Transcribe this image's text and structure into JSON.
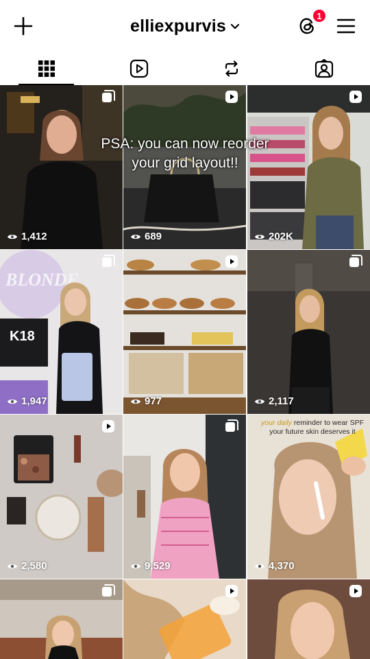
{
  "header": {
    "username": "elliexpurvis",
    "notification_count": "1",
    "icons": [
      "plus-icon",
      "chevron-down-icon",
      "threads-icon",
      "menu-icon"
    ]
  },
  "tabs": [
    {
      "name": "grid",
      "icon": "grid-icon",
      "selected": true
    },
    {
      "name": "reels",
      "icon": "reels-icon",
      "selected": false
    },
    {
      "name": "reposts",
      "icon": "repost-icon",
      "selected": false
    },
    {
      "name": "tagged",
      "icon": "tagged-icon",
      "selected": false
    }
  ],
  "overlay_text": "PSA: you can now reorder your grid layout!!",
  "posts": [
    {
      "views": "1,412",
      "type": "carousel"
    },
    {
      "views": "689",
      "type": "reel"
    },
    {
      "views": "202K",
      "type": "reel"
    },
    {
      "views": "1,947",
      "type": "carousel"
    },
    {
      "views": "977",
      "type": "reel"
    },
    {
      "views": "2,117",
      "type": "carousel"
    },
    {
      "views": "2,580",
      "type": "reel"
    },
    {
      "views": "9,529",
      "type": "carousel"
    },
    {
      "views": "4,370",
      "type": "reel"
    },
    {
      "views": "",
      "type": "carousel"
    },
    {
      "views": "",
      "type": "reel"
    },
    {
      "views": "",
      "type": "reel"
    }
  ],
  "post_captions": {
    "sunscreen_line1_highlight": "your daily",
    "sunscreen_line1_rest": " reminder to wear SPF",
    "sunscreen_line2": "your future skin deserves it"
  },
  "colors": {
    "badge": "#ff0033",
    "text": "#000000",
    "background": "#ffffff"
  }
}
